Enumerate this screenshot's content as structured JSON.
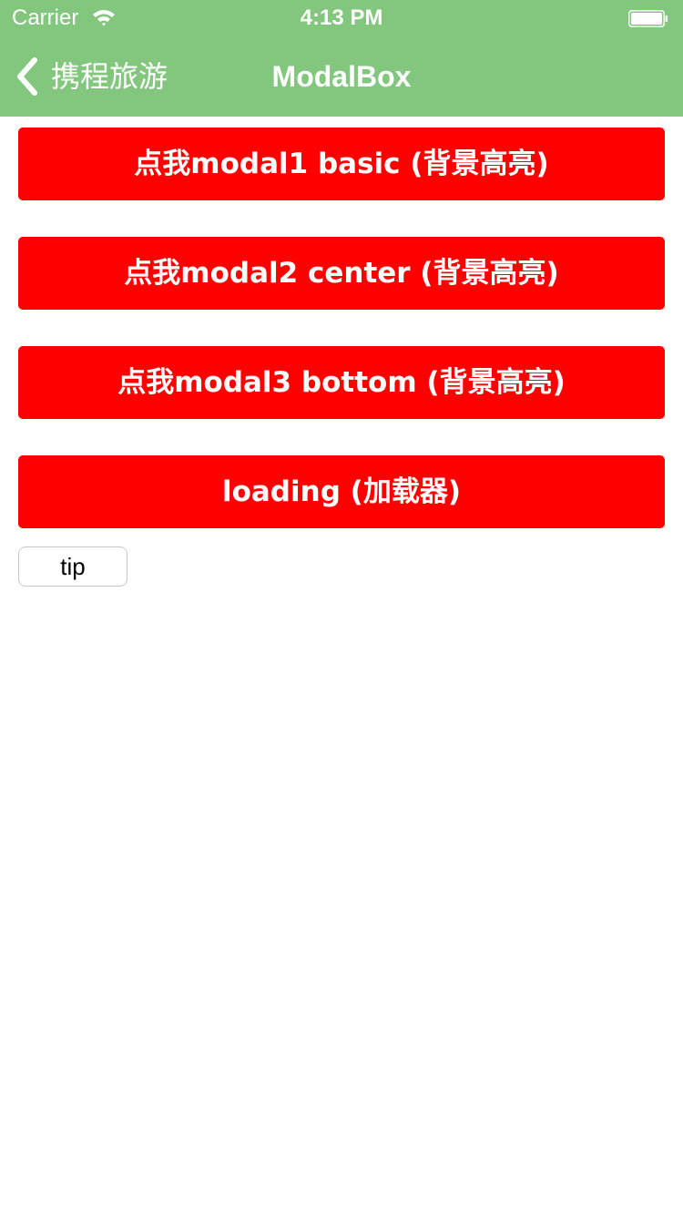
{
  "status_bar": {
    "carrier": "Carrier",
    "time": "4:13 PM"
  },
  "nav": {
    "back_label": "携程旅游",
    "title": "ModalBox",
    "color": "#83c77e"
  },
  "buttons": [
    {
      "label": "点我modal1 basic (背景高亮)"
    },
    {
      "label": "点我modal2 center (背景高亮)"
    },
    {
      "label": "点我modal3 bottom (背景高亮)"
    },
    {
      "label": "loading (加载器)"
    }
  ],
  "button_color": "#ff0000",
  "tip": {
    "label": "tip"
  }
}
